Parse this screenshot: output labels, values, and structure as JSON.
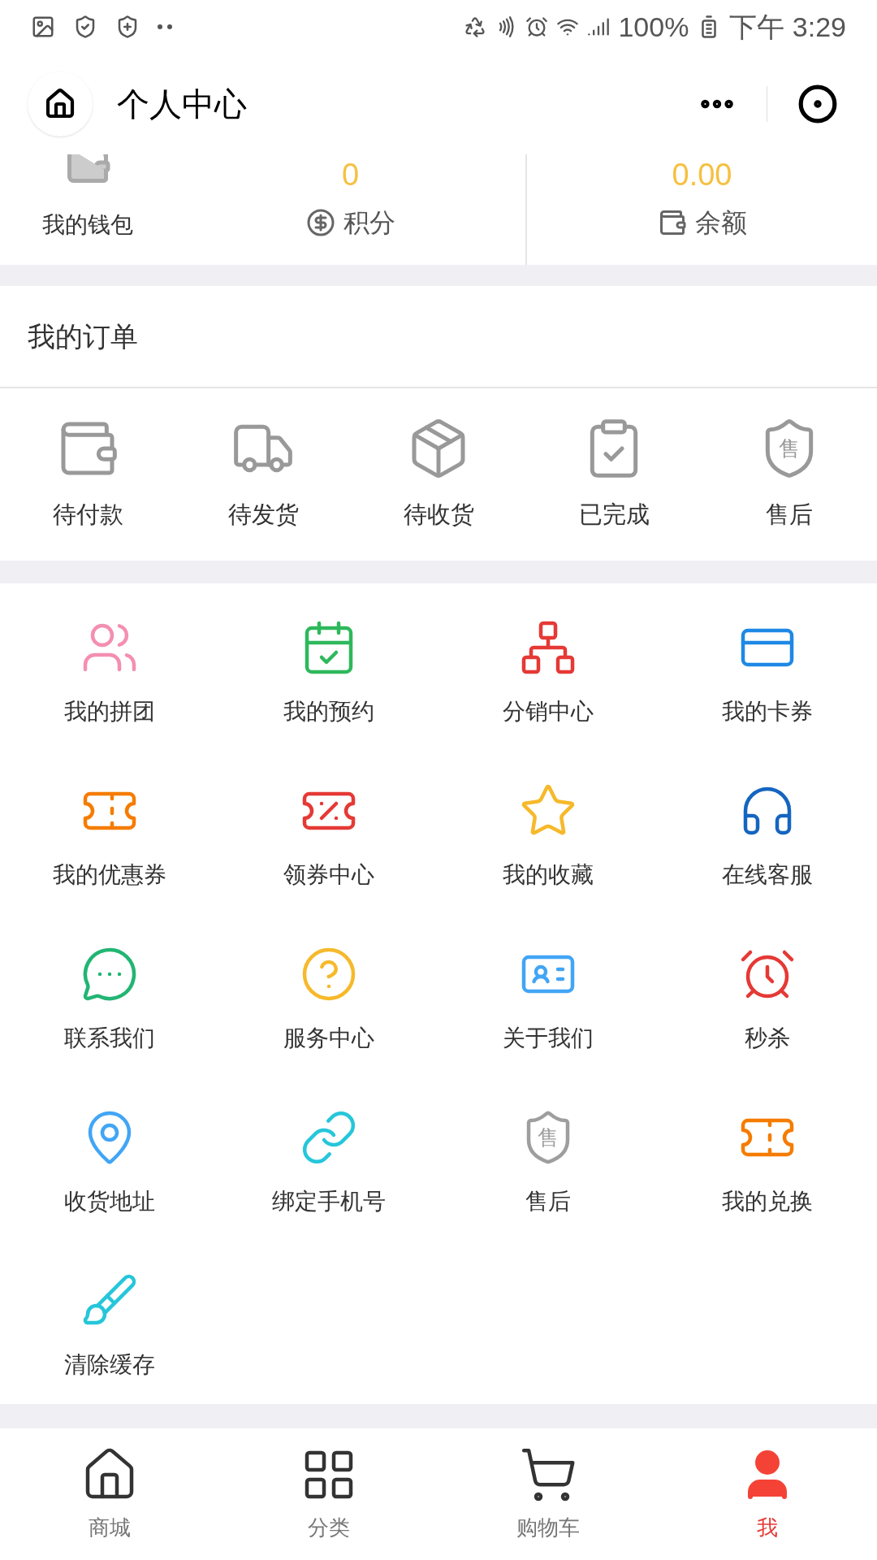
{
  "status_bar": {
    "battery": "100%",
    "time": "下午 3:29"
  },
  "nav": {
    "title": "个人中心"
  },
  "account": {
    "wallet_label": "我的钱包",
    "stats": [
      {
        "value": "0",
        "label": "积分"
      },
      {
        "value": "0.00",
        "label": "余额"
      }
    ]
  },
  "orders": {
    "title": "我的订单",
    "items": [
      {
        "label": "待付款"
      },
      {
        "label": "待发货"
      },
      {
        "label": "待收货"
      },
      {
        "label": "已完成"
      },
      {
        "label": "售后",
        "glyph": "售"
      }
    ]
  },
  "services": [
    {
      "label": "我的拼团",
      "color": "#f48fb1"
    },
    {
      "label": "我的预约",
      "color": "#2eb85c"
    },
    {
      "label": "分销中心",
      "color": "#e53935"
    },
    {
      "label": "我的卡券",
      "color": "#1e88e5"
    },
    {
      "label": "我的优惠券",
      "color": "#f57c00"
    },
    {
      "label": "领券中心",
      "color": "#e53935"
    },
    {
      "label": "我的收藏",
      "color": "#f6b92b"
    },
    {
      "label": "在线客服",
      "color": "#1565c0"
    },
    {
      "label": "联系我们",
      "color": "#22b573"
    },
    {
      "label": "服务中心",
      "color": "#f6b92b"
    },
    {
      "label": "关于我们",
      "color": "#42a5f5"
    },
    {
      "label": "秒杀",
      "color": "#e53935"
    },
    {
      "label": "收货地址",
      "color": "#42a5f5"
    },
    {
      "label": "绑定手机号",
      "color": "#26c6da"
    },
    {
      "label": "售后",
      "color": "#9e9e9e",
      "glyph": "售"
    },
    {
      "label": "我的兑换",
      "color": "#f57c00"
    },
    {
      "label": "清除缓存",
      "color": "#26c6da"
    }
  ],
  "tabbar": [
    {
      "label": "商城",
      "selected": false
    },
    {
      "label": "分类",
      "selected": false
    },
    {
      "label": "购物车",
      "selected": false
    },
    {
      "label": "我",
      "selected": true
    }
  ]
}
